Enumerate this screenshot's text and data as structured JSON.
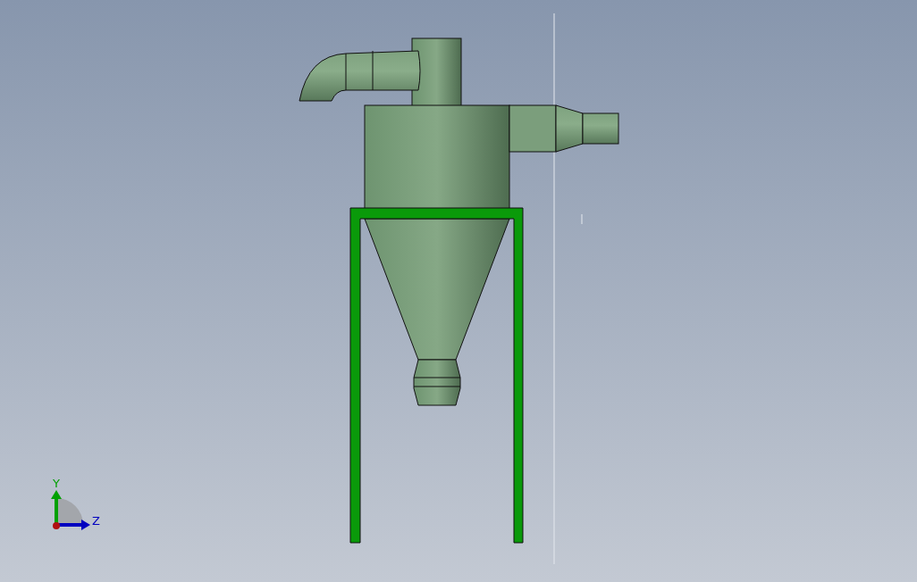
{
  "triad": {
    "axes": [
      {
        "label": "Y",
        "kind": "vertical",
        "color": "#00a000"
      },
      {
        "label": "Z",
        "kind": "horizontal",
        "color": "#0000c0"
      }
    ]
  }
}
